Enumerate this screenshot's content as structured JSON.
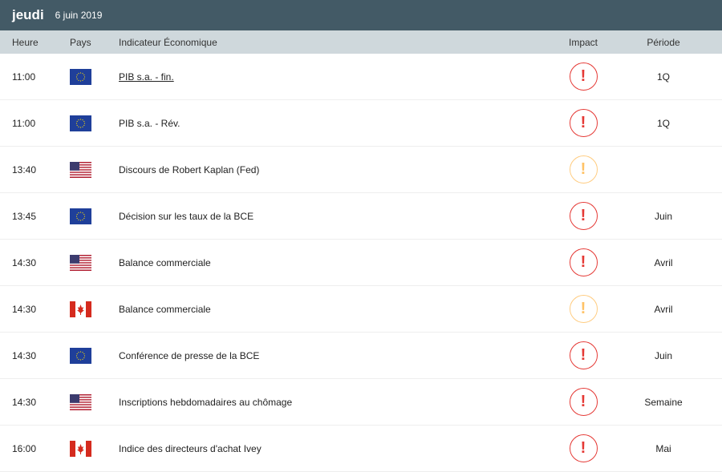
{
  "header": {
    "day": "jeudi",
    "date": "6 juin 2019"
  },
  "columns": {
    "time": "Heure",
    "country": "Pays",
    "indicator": "Indicateur Économique",
    "impact": "Impact",
    "period": "Période"
  },
  "colors": {
    "header_bg": "#435a66",
    "subheader_bg": "#cfd8dc",
    "high": "#e53935",
    "medium": "#ffc266"
  },
  "rows": [
    {
      "time": "11:00",
      "country": "EU",
      "indicator": "PIB s.a. - fin.",
      "impact": "high",
      "impact_icon": "!",
      "period": "1Q",
      "link": true
    },
    {
      "time": "11:00",
      "country": "EU",
      "indicator": "PIB s.a. - Rév.",
      "impact": "high",
      "impact_icon": "!",
      "period": "1Q"
    },
    {
      "time": "13:40",
      "country": "US",
      "indicator": "Discours de Robert Kaplan (Fed)",
      "impact": "med",
      "impact_icon": "!",
      "period": ""
    },
    {
      "time": "13:45",
      "country": "EU",
      "indicator": "Décision sur les taux de la BCE",
      "impact": "high",
      "impact_icon": "!",
      "period": "Juin"
    },
    {
      "time": "14:30",
      "country": "US",
      "indicator": "Balance commerciale",
      "impact": "high",
      "impact_icon": "!",
      "period": "Avril"
    },
    {
      "time": "14:30",
      "country": "CA",
      "indicator": "Balance commerciale",
      "impact": "med",
      "impact_icon": "!",
      "period": "Avril"
    },
    {
      "time": "14:30",
      "country": "EU",
      "indicator": "Conférence de presse de la BCE",
      "impact": "high",
      "impact_icon": "!",
      "period": "Juin"
    },
    {
      "time": "14:30",
      "country": "US",
      "indicator": "Inscriptions hebdomadaires au chômage",
      "impact": "high",
      "impact_icon": "!",
      "period": "Semaine"
    },
    {
      "time": "16:00",
      "country": "CA",
      "indicator": "Indice des directeurs d'achat Ivey",
      "impact": "high",
      "impact_icon": "!",
      "period": "Mai"
    }
  ]
}
